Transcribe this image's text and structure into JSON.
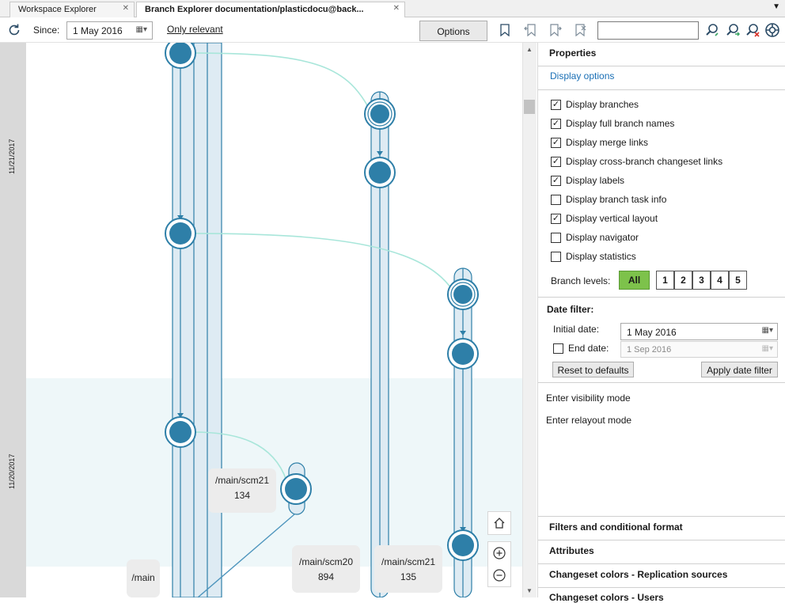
{
  "tabs": [
    {
      "label": "Workspace Explorer",
      "active": false
    },
    {
      "label": "Branch Explorer documentation/plasticdocu@back...",
      "active": true
    }
  ],
  "toolbar": {
    "since_label": "Since:",
    "since_date": "1 May 2016",
    "only_relevant": "Only relevant",
    "options_label": "Options",
    "search_value": ""
  },
  "canvas": {
    "dates": [
      "11/21/2017",
      "11/20/2017"
    ],
    "labels": [
      {
        "text": [
          "/main/scm21",
          "134"
        ]
      },
      {
        "text": [
          "/main"
        ]
      },
      {
        "text": [
          "/main/scm20",
          "894"
        ]
      },
      {
        "text": [
          "/main/scm21",
          "135"
        ]
      }
    ],
    "colors": {
      "node": "#2e7fa8",
      "branch_fill": "#deebf3",
      "merge_link": "#a8e6da",
      "band": "#eef7f9"
    }
  },
  "panel": {
    "properties": "Properties",
    "display_options": "Display options",
    "checkboxes": [
      {
        "label": "Display branches",
        "checked": true
      },
      {
        "label": "Display full branch names",
        "checked": true
      },
      {
        "label": "Display merge links",
        "checked": true
      },
      {
        "label": "Display cross-branch changeset links",
        "checked": true
      },
      {
        "label": "Display labels",
        "checked": true
      },
      {
        "label": "Display branch task info",
        "checked": false
      },
      {
        "label": "Display vertical layout",
        "checked": true
      },
      {
        "label": "Display navigator",
        "checked": false
      },
      {
        "label": "Display statistics",
        "checked": false
      }
    ],
    "branch_levels_label": "Branch levels:",
    "branch_levels": [
      "All",
      "1",
      "2",
      "3",
      "4",
      "5"
    ],
    "branch_levels_selected": "All",
    "date_filter": "Date filter:",
    "initial_date_label": "Initial date:",
    "initial_date": "1 May 2016",
    "end_date_label": "End date:",
    "end_date": "1 Sep 2016",
    "end_date_checked": false,
    "reset_label": "Reset to defaults",
    "apply_label": "Apply date filter",
    "visibility_mode": "Enter visibility mode",
    "relayout_mode": "Enter relayout mode",
    "sections": [
      "Filters and conditional format",
      "Attributes",
      "Changeset colors - Replication sources",
      "Changeset colors - Users"
    ]
  }
}
